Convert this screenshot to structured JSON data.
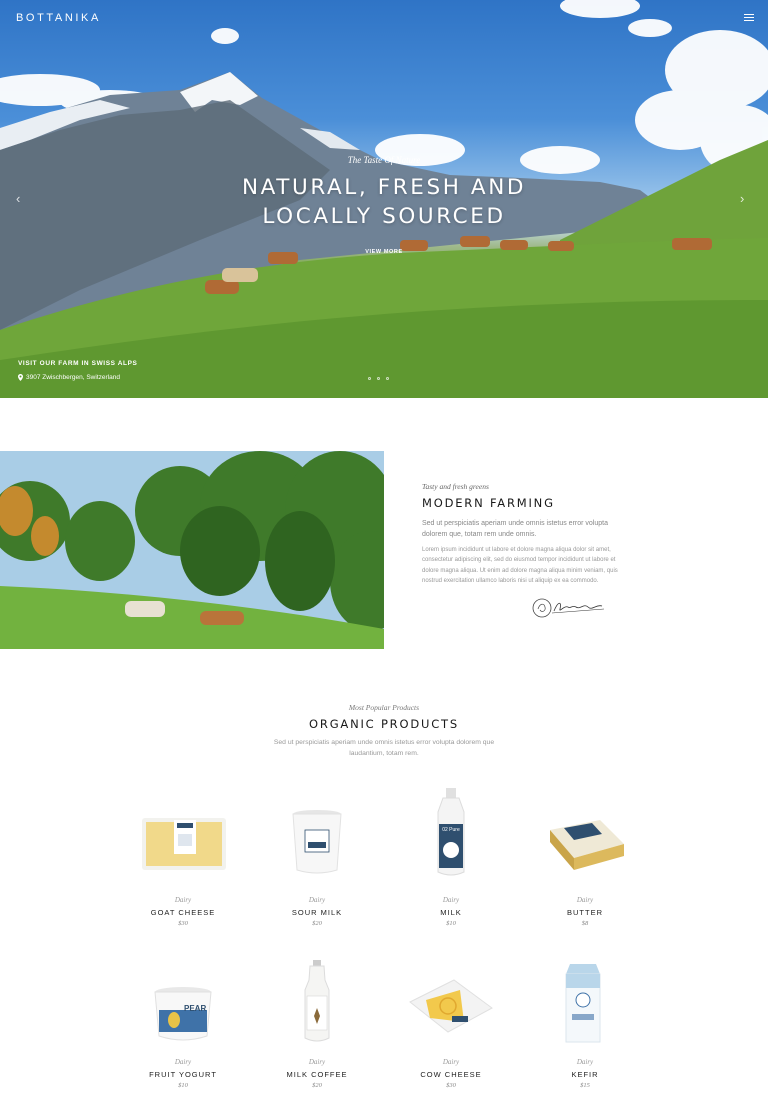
{
  "brand": {
    "logo": "BOTTANIKA"
  },
  "hero": {
    "subtitle": "The Taste Of Nature",
    "title_line1": "NATURAL, FRESH AND",
    "title_line2": "LOCALLY SOURCED",
    "button_label": "VIEW MORE",
    "visit_label": "VISIT OUR FARM IN SWISS ALPS",
    "address": "3907 Zwischbergen, Switzerland",
    "icons": {
      "menu": "menu-icon",
      "prev": "chevron-left-icon",
      "next": "chevron-right-icon",
      "location": "location-pin-icon"
    }
  },
  "farming": {
    "eyebrow": "Tasty and fresh greens",
    "title": "MODERN FARMING",
    "lead": "Sed ut perspiciatis aperiam unde omnis istetus error volupta dolorem que, totam rem unde omnis.",
    "body": "Lorem ipsum incididunt ut labore et dolore magna aliqua dolor sit amet, consectetur adipiscing elit, sed do eiusmod tempor incididunt ut labore et dolore magna aliqua. Ut enim ad dolore magna aliqua minim veniam, quis nostrud exercitation ullamco laboris nisi ut aliquip ex ea commodo."
  },
  "products_section": {
    "eyebrow": "Most Popular Products",
    "title": "ORGANIC PRODUCTS",
    "description": "Sed ut perspiciatis aperiam unde omnis istetus error volupta dolorem que laudantium, totam rem.",
    "items": [
      {
        "category": "Dairy",
        "name": "GOAT CHEESE",
        "price": "$30"
      },
      {
        "category": "Dairy",
        "name": "SOUR MILK",
        "price": "$20"
      },
      {
        "category": "Dairy",
        "name": "MILK",
        "price": "$10"
      },
      {
        "category": "Dairy",
        "name": "BUTTER",
        "price": "$8"
      },
      {
        "category": "Dairy",
        "name": "FRUIT YOGURT",
        "price": "$10"
      },
      {
        "category": "Dairy",
        "name": "MILK COFFEE",
        "price": "$20"
      },
      {
        "category": "Dairy",
        "name": "COW CHEESE",
        "price": "$30"
      },
      {
        "category": "Dairy",
        "name": "KEFIR",
        "price": "$15"
      }
    ],
    "package_labels": {
      "yogurt": "PEAR",
      "milk_bottle": "02 Pure"
    }
  },
  "colors": {
    "brand_blue": "#2f4f6f",
    "meadow_green": "#5b9428",
    "sky_blue": "#3f82d0"
  }
}
